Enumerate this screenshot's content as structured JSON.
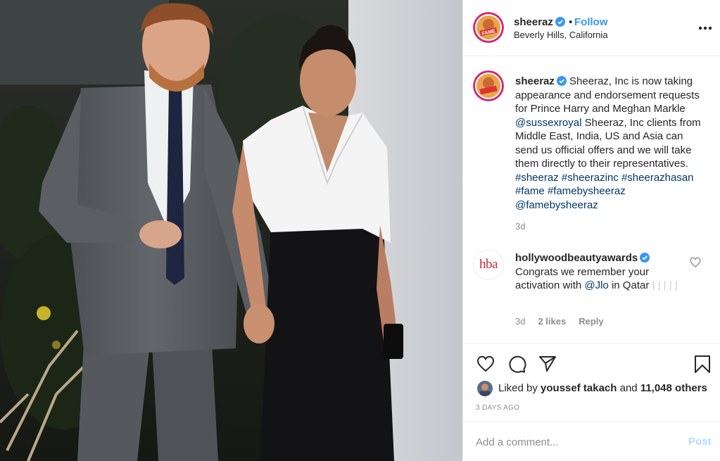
{
  "post": {
    "username": "sheeraz",
    "follow_label": "Follow",
    "dot": "•",
    "location": "Beverly Hills, California",
    "avatar_text": "FAME"
  },
  "caption": {
    "username": "sheeraz",
    "text_1": " Sheeraz, Inc is now taking appearance and endorsement requests for Prince Harry and Meghan Markle ",
    "mention": "@sussexroyal",
    "text_2": " Sheeraz, Inc clients from Middle East, India, US and Asia can send us official offers and we will take them directly to their representatives. ",
    "tags": [
      "#sheeraz",
      "#sheerazinc",
      "#sheerazhasan",
      "#fame",
      "#famebysheeraz"
    ],
    "mention_2": "@famebysheeraz",
    "time": "3d"
  },
  "comment": {
    "avatar_text": "hba",
    "username": "hollywoodbeautyawards",
    "text_1": "Congrats we remember your activation with ",
    "mention": "@Jlo",
    "text_2": " in Qatar ",
    "faint_glyphs": "| | | | |",
    "time": "3d",
    "likes": "2 likes",
    "reply_label": "Reply"
  },
  "likes": {
    "prefix": "Liked by ",
    "user": "youssef takach",
    "middle": " and ",
    "count": "11,048 others"
  },
  "date_label": "3 DAYS AGO",
  "add_comment": {
    "placeholder": "Add a comment...",
    "post_label": "Post"
  },
  "icons": {
    "verified": "verified-badge-icon",
    "more": "more-options-icon",
    "like": "heart-icon",
    "comment": "comment-bubble-icon",
    "share": "paper-plane-icon",
    "save": "bookmark-icon"
  },
  "colors": {
    "link_blue": "#3897f0",
    "mention_blue": "#00376b",
    "muted": "#8e8e8e",
    "post_disabled": "#b3dbff"
  }
}
